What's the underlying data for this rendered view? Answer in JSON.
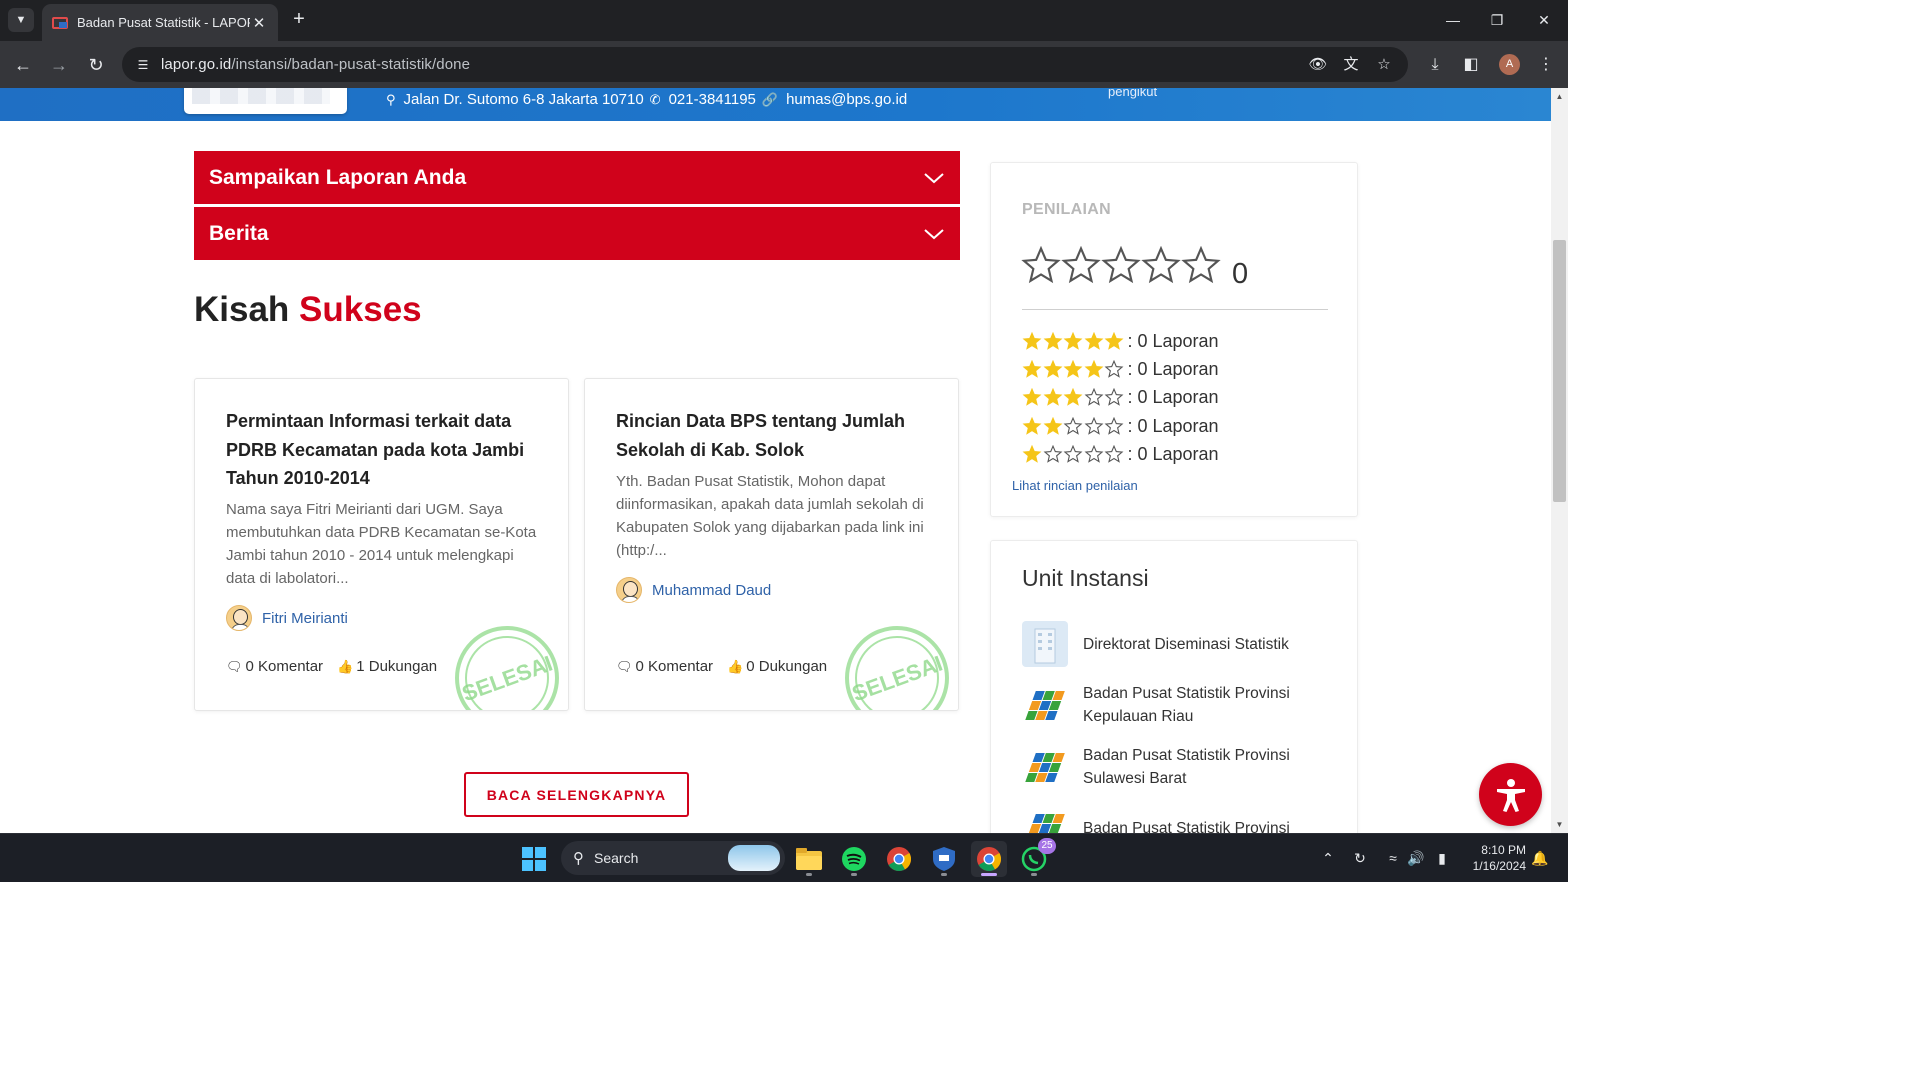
{
  "browser": {
    "tab_title": "Badan Pusat Statistik - LAPOR!",
    "url_host": "lapor.go.id",
    "url_path": "/instansi/badan-pusat-statistik/done",
    "profile_initial": "A"
  },
  "header": {
    "address": "Jalan Dr. Sutomo 6-8 Jakarta 10710",
    "phone": "021-3841195",
    "email": "humas@bps.go.id",
    "followers_label": "pengikut"
  },
  "accordions": [
    {
      "title": "Sampaikan Laporan Anda"
    },
    {
      "title": "Berita"
    }
  ],
  "success_section": {
    "title_part1": "Kisah",
    "title_part2": "Sukses",
    "cards": [
      {
        "title": "Permintaan Informasi terkait data PDRB Kecamatan pada kota Jambi Tahun 2010-2014",
        "excerpt": "Nama saya Fitri Meirianti dari UGM. Saya membutuhkan data PDRB Kecamatan se-Kota Jambi tahun 2010 - 2014 untuk melengkapi data di labolatori...",
        "author": "Fitri Meirianti",
        "comments": "0 Komentar",
        "supports": "1 Dukungan",
        "stamp": "SELESAI"
      },
      {
        "title": "Rincian Data BPS tentang Jumlah Sekolah di Kab. Solok",
        "excerpt": "Yth. Badan Pusat Statistik, Mohon dapat diinformasikan, apakah data jumlah sekolah di Kabupaten Solok yang dijabarkan pada link ini (http:/...",
        "author": "Muhammad Daud",
        "comments": "0 Komentar",
        "supports": "0 Dukungan",
        "stamp": "SELESAI"
      }
    ],
    "more_button": "BACA SELENGKAPNYA"
  },
  "rating": {
    "label": "PENILAIAN",
    "value": "0",
    "average_stars": 0,
    "rows": [
      {
        "stars": 5,
        "count": ": 0 Laporan"
      },
      {
        "stars": 4,
        "count": ": 0 Laporan"
      },
      {
        "stars": 3,
        "count": ": 0 Laporan"
      },
      {
        "stars": 2,
        "count": ": 0 Laporan"
      },
      {
        "stars": 1,
        "count": ": 0 Laporan"
      }
    ],
    "link": "Lihat rincian penilaian"
  },
  "units": {
    "title": "Unit Instansi",
    "items": [
      {
        "name": "Direktorat Diseminasi Statistik",
        "icon": "building-icon"
      },
      {
        "name": "Badan Pusat Statistik Provinsi Kepulauan Riau",
        "icon": "bps-logo-icon"
      },
      {
        "name": "Badan Pusat Statistik Provinsi Sulawesi Barat",
        "icon": "bps-logo-icon"
      },
      {
        "name": "Badan Pusat Statistik Provinsi",
        "icon": "bps-logo-icon"
      }
    ]
  },
  "colors": {
    "brand_red": "#d0021b",
    "header_blue": "#1f6fc4",
    "star_gold": "#f5c518",
    "link_blue": "#2f62a8",
    "stamp_green": "#8fd98a"
  },
  "taskbar": {
    "search_placeholder": "Search",
    "whatsapp_badge": "25",
    "time": "8:10 PM",
    "date": "1/16/2024"
  }
}
